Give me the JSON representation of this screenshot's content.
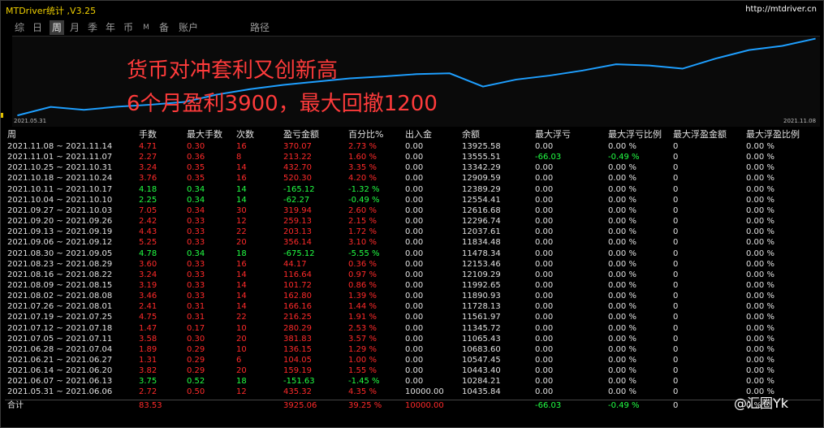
{
  "window": {
    "title": "MTDriver统计 ,V3.25",
    "url": "http://mtdriver.cn"
  },
  "tabs": [
    {
      "label": "综",
      "active": false
    },
    {
      "label": "日",
      "active": false
    },
    {
      "label": "周",
      "active": true
    },
    {
      "label": "月",
      "active": false
    },
    {
      "label": "季",
      "active": false
    },
    {
      "label": "年",
      "active": false
    },
    {
      "label": "币",
      "active": false
    },
    {
      "label": "M",
      "active": false
    },
    {
      "label": "备",
      "active": false
    },
    {
      "label": "账户",
      "active": false
    },
    {
      "label": "路径",
      "active": false
    }
  ],
  "overlay": {
    "line1": "货币对冲套利又创新高",
    "line2": "6个月盈利3900，最大回撤1200"
  },
  "chart_data": {
    "type": "line",
    "x_start_label": "2021.05.31",
    "x_end_label": "2021.11.08",
    "line_color": "#1e9fff",
    "series": [
      {
        "values": [
          10435.84,
          10284.21,
          10443.4,
          10547.45,
          10683.6,
          11065.43,
          11345.72,
          11561.97,
          11728.13,
          11890.93,
          11992.65,
          12109.29,
          12153.46,
          11478.34,
          11834.48,
          12037.61,
          12296.74,
          12616.68,
          12554.41,
          12389.29,
          12909.59,
          13342.29,
          13555.51,
          13925.58
        ]
      }
    ]
  },
  "table": {
    "headers": [
      "周",
      "手数",
      "最大手数",
      "次数",
      "盈亏金额",
      "百分比%",
      "出入金",
      "余额",
      "最大浮亏",
      "最大浮亏比例",
      "最大浮盈金额",
      "最大浮盈比例"
    ],
    "rows": [
      {
        "sign": "pos",
        "cells": [
          "2021.11.08 ~ 2021.11.14",
          "4.71",
          "0.30",
          "16",
          "370.07",
          "2.73 %",
          "0.00",
          "13925.58",
          "0.00",
          "0.00 %",
          "0",
          "0.00 %"
        ]
      },
      {
        "sign": "pos",
        "cells": [
          "2021.11.01 ~ 2021.11.07",
          "2.27",
          "0.36",
          "8",
          "213.22",
          "1.60 %",
          "0.00",
          "13555.51",
          "-66.03",
          "-0.49 %",
          "0",
          "0.00 %"
        ]
      },
      {
        "sign": "pos",
        "cells": [
          "2021.10.25 ~ 2021.10.31",
          "3.24",
          "0.35",
          "14",
          "432.70",
          "3.35 %",
          "0.00",
          "13342.29",
          "0.00",
          "0.00 %",
          "0",
          "0.00 %"
        ]
      },
      {
        "sign": "pos",
        "cells": [
          "2021.10.18 ~ 2021.10.24",
          "3.76",
          "0.35",
          "16",
          "520.30",
          "4.20 %",
          "0.00",
          "12909.59",
          "0.00",
          "0.00 %",
          "0",
          "0.00 %"
        ]
      },
      {
        "sign": "neg",
        "cells": [
          "2021.10.11 ~ 2021.10.17",
          "4.18",
          "0.34",
          "14",
          "-165.12",
          "-1.32 %",
          "0.00",
          "12389.29",
          "0.00",
          "0.00 %",
          "0",
          "0.00 %"
        ]
      },
      {
        "sign": "neg",
        "cells": [
          "2021.10.04 ~ 2021.10.10",
          "2.25",
          "0.34",
          "14",
          "-62.27",
          "-0.49 %",
          "0.00",
          "12554.41",
          "0.00",
          "0.00 %",
          "0",
          "0.00 %"
        ]
      },
      {
        "sign": "pos",
        "cells": [
          "2021.09.27 ~ 2021.10.03",
          "7.05",
          "0.34",
          "30",
          "319.94",
          "2.60 %",
          "0.00",
          "12616.68",
          "0.00",
          "0.00 %",
          "0",
          "0.00 %"
        ]
      },
      {
        "sign": "pos",
        "cells": [
          "2021.09.20 ~ 2021.09.26",
          "2.42",
          "0.33",
          "12",
          "259.13",
          "2.15 %",
          "0.00",
          "12296.74",
          "0.00",
          "0.00 %",
          "0",
          "0.00 %"
        ]
      },
      {
        "sign": "pos",
        "cells": [
          "2021.09.13 ~ 2021.09.19",
          "4.43",
          "0.33",
          "22",
          "203.13",
          "1.72 %",
          "0.00",
          "12037.61",
          "0.00",
          "0.00 %",
          "0",
          "0.00 %"
        ]
      },
      {
        "sign": "pos",
        "cells": [
          "2021.09.06 ~ 2021.09.12",
          "5.25",
          "0.33",
          "20",
          "356.14",
          "3.10 %",
          "0.00",
          "11834.48",
          "0.00",
          "0.00 %",
          "0",
          "0.00 %"
        ]
      },
      {
        "sign": "neg",
        "cells": [
          "2021.08.30 ~ 2021.09.05",
          "4.78",
          "0.34",
          "18",
          "-675.12",
          "-5.55 %",
          "0.00",
          "11478.34",
          "0.00",
          "0.00 %",
          "0",
          "0.00 %"
        ]
      },
      {
        "sign": "pos",
        "cells": [
          "2021.08.23 ~ 2021.08.29",
          "3.60",
          "0.33",
          "16",
          "44.17",
          "0.36 %",
          "0.00",
          "12153.46",
          "0.00",
          "0.00 %",
          "0",
          "0.00 %"
        ]
      },
      {
        "sign": "pos",
        "cells": [
          "2021.08.16 ~ 2021.08.22",
          "3.24",
          "0.33",
          "14",
          "116.64",
          "0.97 %",
          "0.00",
          "12109.29",
          "0.00",
          "0.00 %",
          "0",
          "0.00 %"
        ]
      },
      {
        "sign": "pos",
        "cells": [
          "2021.08.09 ~ 2021.08.15",
          "3.19",
          "0.33",
          "14",
          "101.72",
          "0.86 %",
          "0.00",
          "11992.65",
          "0.00",
          "0.00 %",
          "0",
          "0.00 %"
        ]
      },
      {
        "sign": "pos",
        "cells": [
          "2021.08.02 ~ 2021.08.08",
          "3.46",
          "0.33",
          "14",
          "162.80",
          "1.39 %",
          "0.00",
          "11890.93",
          "0.00",
          "0.00 %",
          "0",
          "0.00 %"
        ]
      },
      {
        "sign": "pos",
        "cells": [
          "2021.07.26 ~ 2021.08.01",
          "2.41",
          "0.31",
          "14",
          "166.16",
          "1.44 %",
          "0.00",
          "11728.13",
          "0.00",
          "0.00 %",
          "0",
          "0.00 %"
        ]
      },
      {
        "sign": "pos",
        "cells": [
          "2021.07.19 ~ 2021.07.25",
          "4.75",
          "0.31",
          "22",
          "216.25",
          "1.91 %",
          "0.00",
          "11561.97",
          "0.00",
          "0.00 %",
          "0",
          "0.00 %"
        ]
      },
      {
        "sign": "pos",
        "cells": [
          "2021.07.12 ~ 2021.07.18",
          "1.47",
          "0.17",
          "10",
          "280.29",
          "2.53 %",
          "0.00",
          "11345.72",
          "0.00",
          "0.00 %",
          "0",
          "0.00 %"
        ]
      },
      {
        "sign": "pos",
        "cells": [
          "2021.07.05 ~ 2021.07.11",
          "3.58",
          "0.30",
          "20",
          "381.83",
          "3.57 %",
          "0.00",
          "11065.43",
          "0.00",
          "0.00 %",
          "0",
          "0.00 %"
        ]
      },
      {
        "sign": "pos",
        "cells": [
          "2021.06.28 ~ 2021.07.04",
          "1.89",
          "0.29",
          "10",
          "136.15",
          "1.29 %",
          "0.00",
          "10683.60",
          "0.00",
          "0.00 %",
          "0",
          "0.00 %"
        ]
      },
      {
        "sign": "pos",
        "cells": [
          "2021.06.21 ~ 2021.06.27",
          "1.31",
          "0.29",
          "6",
          "104.05",
          "1.00 %",
          "0.00",
          "10547.45",
          "0.00",
          "0.00 %",
          "0",
          "0.00 %"
        ]
      },
      {
        "sign": "pos",
        "cells": [
          "2021.06.14 ~ 2021.06.20",
          "3.82",
          "0.29",
          "20",
          "159.19",
          "1.55 %",
          "0.00",
          "10443.40",
          "0.00",
          "0.00 %",
          "0",
          "0.00 %"
        ]
      },
      {
        "sign": "neg",
        "cells": [
          "2021.06.07 ~ 2021.06.13",
          "3.75",
          "0.52",
          "18",
          "-151.63",
          "-1.45 %",
          "0.00",
          "10284.21",
          "0.00",
          "0.00 %",
          "0",
          "0.00 %"
        ]
      },
      {
        "sign": "pos",
        "cells": [
          "2021.05.31 ~ 2021.06.06",
          "2.72",
          "0.50",
          "12",
          "435.32",
          "4.35 %",
          "10000.00",
          "10435.84",
          "0.00",
          "0.00 %",
          "0",
          "0.00 %"
        ]
      }
    ],
    "total": [
      "合计",
      "83.53",
      "",
      "",
      "3925.06",
      "39.25 %",
      "10000.00",
      "",
      "-66.03",
      "-0.49 %",
      "0",
      "0 %"
    ]
  },
  "watermark": "@汇圈Yk",
  "colors": {
    "positive": "#ff2a2a",
    "negative": "#22ff44",
    "neutral": "#e0e0e0",
    "title": "#f0d000"
  }
}
